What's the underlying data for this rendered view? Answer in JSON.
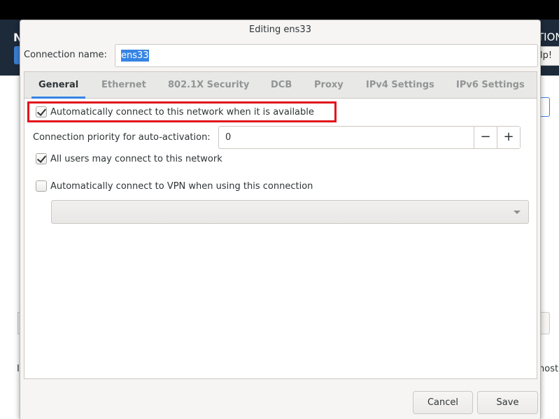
{
  "background": {
    "header_left_fragment": "N",
    "header_right_fragment": "TION",
    "help_button_fragment": "lp!",
    "left_text_fragment": "I",
    "right_text_fragment": "nost"
  },
  "dialog": {
    "title": "Editing ens33",
    "connection_name_label": "Connection name:",
    "connection_name_value": "ens33",
    "tabs": [
      {
        "label": "General",
        "active": true
      },
      {
        "label": "Ethernet",
        "active": false
      },
      {
        "label": "802.1X Security",
        "active": false
      },
      {
        "label": "DCB",
        "active": false
      },
      {
        "label": "Proxy",
        "active": false
      },
      {
        "label": "IPv4 Settings",
        "active": false
      },
      {
        "label": "IPv6 Settings",
        "active": false
      }
    ],
    "general": {
      "auto_connect_label": "Automatically connect to this network when it is available",
      "auto_connect_checked": true,
      "priority_label": "Connection priority for auto-activation:",
      "priority_value": "0",
      "priority_minus": "−",
      "priority_plus": "+",
      "all_users_label": "All users may connect to this network",
      "all_users_checked": true,
      "vpn_label": "Automatically connect to VPN when using this connection",
      "vpn_checked": false,
      "vpn_selected": ""
    },
    "buttons": {
      "cancel": "Cancel",
      "save": "Save"
    },
    "colors": {
      "accent": "#3584e4",
      "highlight": "#e0131b"
    }
  }
}
